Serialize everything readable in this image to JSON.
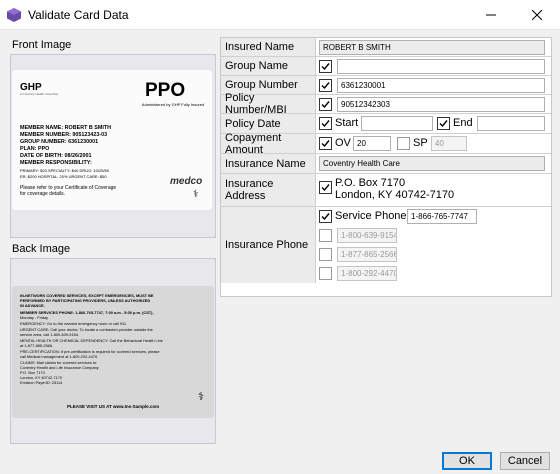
{
  "window": {
    "title": "Validate Card Data"
  },
  "front_image": {
    "label": "Front Image",
    "logo": "GHP",
    "logo_sub": "A Coventry Health Care Plan",
    "plan_type": "PPO",
    "administered": "Administered by GHP Fully Insured",
    "lines": [
      "MEMBER NAME:  ROBERT B SMITH",
      "MEMBER NUMBER:  905123423-03",
      "GROUP NUMBER:  6361230001",
      "PLAN:  PPO",
      "DATE OF BIRTH:  08/26/2001",
      "MEMBER RESPONSIBILITY:"
    ],
    "copays": [
      "PRIMARY: $20        SPECIALTY: $40        DRUG: 10/25/50",
      "ER: $200            HOSPITAL: 20%         URGENT CARE: $50"
    ],
    "footer": [
      "Please refer to your Certificate of Coverage",
      "for coverage details."
    ],
    "pharmacy_logo": "medco"
  },
  "back_image": {
    "label": "Back Image",
    "lines": [
      "IN-NETWORK COVERED SERVICES, EXCEPT EMERGENCIES, MUST BE",
      "PERFORMED BY PARTICIPATING PROVIDERS, UNLESS AUTHORIZED",
      "IN ADVANCE.",
      "MEMBER SERVICES PHONE:  1-866-765-7747, 7:00 a.m - 5:00 p.m. (CST),",
      "Monday - Friday",
      "EMERGENCY:  Go to the nearest emergency room or call 911.",
      "URGENT CARE:  Call your doctor. To locate a contracted provider outside the",
      "service area, call 1-800-639-9154.",
      "MENTAL HEALTH OR CHEMICAL DEPENDENCY:  Call the Behavioral Health Line",
      "at 1-877-865-2566.",
      "PRE-CERTIFICATION:  If pre-certification is required for covered services, please",
      "call Medical management at 1-800-292-4470.",
      "CLAIMS: Mail claims for covered services to:",
      "Coventry Health and Life Insurance Company",
      "P.O. Box 7170",
      "London, KY 40742-7170",
      "Emdeon PayerID: 25114"
    ],
    "website": "PLEASE VISIT US AT www.Ins-Sample.com"
  },
  "fields": {
    "insured_name": {
      "label": "Insured Name",
      "value": "ROBERT B SMITH"
    },
    "group_name": {
      "label": "Group Name",
      "value": ""
    },
    "group_number": {
      "label": "Group Number",
      "value": "6361230001"
    },
    "policy_number": {
      "label": "Policy Number/MBI",
      "value": "90512342303"
    },
    "policy_date": {
      "label": "Policy Date",
      "start_label": "Start",
      "start_value": "",
      "end_label": "End",
      "end_value": ""
    },
    "copayment": {
      "label": "Copayment Amount",
      "ov_label": "OV",
      "ov_value": "20",
      "sp_label": "SP",
      "sp_value": "40"
    },
    "insurance_name": {
      "label": "Insurance Name",
      "value": "Coventry Health Care"
    },
    "insurance_address": {
      "label": "Insurance Address",
      "line1": "P.O. Box 7170",
      "line2": "London, KY 40742-7170"
    },
    "insurance_phone": {
      "label": "Insurance Phone",
      "service_label": "Service Phone:",
      "service_value": "1-866-765-7747",
      "alt_phones": [
        "1-800-639-9154",
        "1-877-865-2566",
        "1-800-292-4470"
      ]
    }
  },
  "buttons": {
    "ok": "OK",
    "cancel": "Cancel"
  },
  "colors": {
    "accent": "#0078d7",
    "icon_purple": "#6a4aa8"
  }
}
